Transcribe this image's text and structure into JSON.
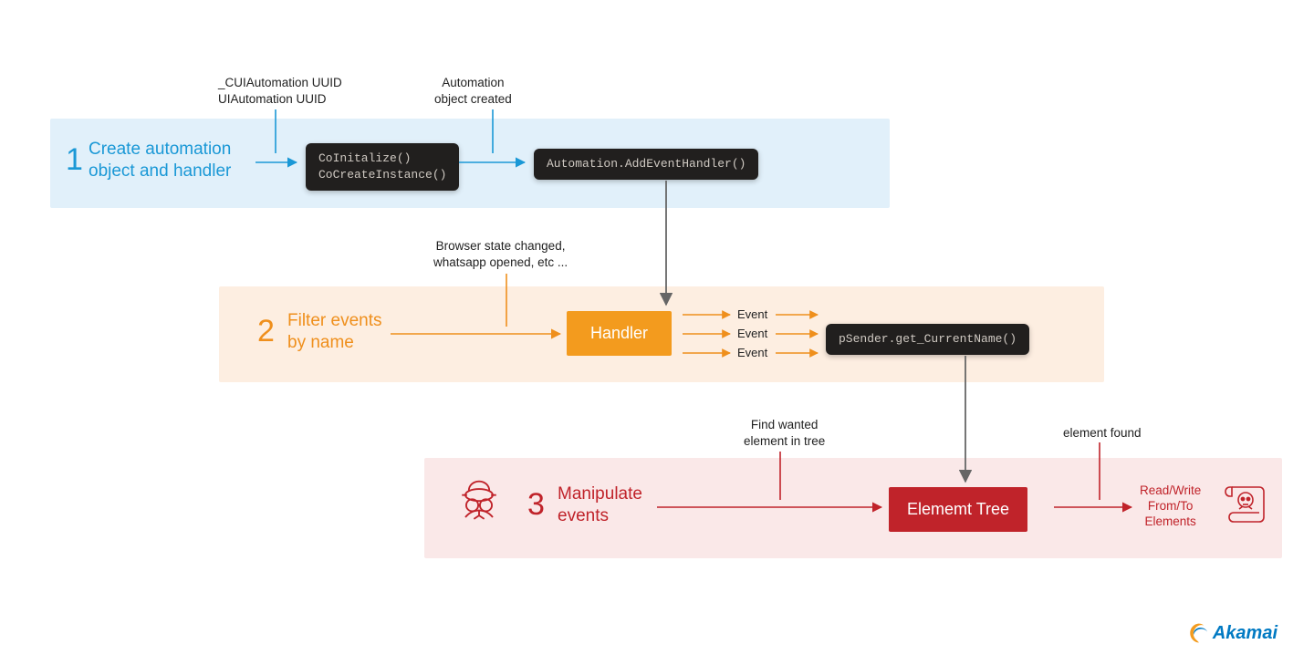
{
  "panels": {
    "step1": {
      "number": "1",
      "title": "Create automation\nobject and handler",
      "note_uuid": "_CUIAutomation UUID\nUIAutomation UUID",
      "note_created": "Automation\nobject created",
      "code1": "CoInitalize()\nCoCreateInstance()",
      "code2": "Automation.AddEventHandler()"
    },
    "step2": {
      "number": "2",
      "title": "Filter events\nby name",
      "note_browser": "Browser state changed,\nwhatsapp opened, etc ...",
      "handler_label": "Handler",
      "event_labels": [
        "Event",
        "Event",
        "Event"
      ],
      "code": "pSender.get_CurrentName()"
    },
    "step3": {
      "number": "3",
      "title": "Manipulate\nevents",
      "note_find": "Find wanted\nelement in tree",
      "note_found": "element found",
      "etree_label": "Elememt Tree",
      "action_label": "Read/Write\nFrom/To\nElements"
    }
  },
  "brand": {
    "name": "Akamai"
  }
}
